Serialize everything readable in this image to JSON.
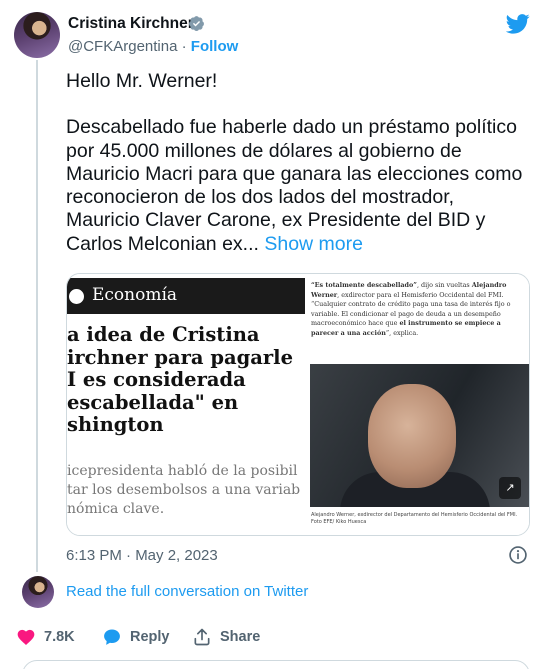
{
  "author": {
    "name": "Cristina Kirchner",
    "handle": "@CFKArgentina",
    "separator": "·",
    "follow_label": "Follow"
  },
  "tweet": {
    "greeting": "Hello Mr. Werner!",
    "body": "Descabellado fue haberle dado un préstamo político por 45.000 millones de dólares al gobierno de Mauricio Macri para que ganara las elecciones como reconocieron de los dos lados del mostrador, Mauricio Claver Carone, ex Presidente del BID y Carlos Melconian ex...",
    "show_more": "Show more",
    "timestamp": "6:13 PM · May 2, 2023"
  },
  "media": {
    "section": "Economía",
    "headline_lines": [
      "a idea de Cristina",
      "irchner para pagarle",
      "I es considerada",
      "escabellada\" en",
      "shington"
    ],
    "sub_lines": [
      "icepresidenta habló de la posibil",
      "tar los desembolsos a una variab",
      "nómica clave."
    ],
    "quote_parts": {
      "q1": "“Es totalmente descabellado”",
      "q2": ", dijo sin vueltas ",
      "q3": "Alejandro Werner",
      "q4": ", exdirector para el Hemisferio Occidental del FMI. “Cualquier contrato de crédito paga una tasa de interés fijo o variable. El condicionar el pago de deuda a un desempeño macroeconómico hace que ",
      "q5": "el instrumento se empiece a parecer a una acción",
      "q6": "”, explica."
    },
    "caption": "Alejandro Werner, exdirector del Departamento del Hemisferio Occidental del FMI. Foto EFE/ Kiko Huesca",
    "expand_icon": "↗"
  },
  "read_conversation": "Read the full conversation on Twitter",
  "actions": {
    "like_count": "7.8K",
    "reply_label": "Reply",
    "share_label": "Share"
  },
  "colors": {
    "accent": "#1d9bf0",
    "like": "#f91880",
    "text_secondary": "#536471"
  },
  "icons": [
    "verified-badge-icon",
    "twitter-bird-icon",
    "info-icon",
    "heart-icon",
    "reply-bubble-icon",
    "share-icon",
    "expand-icon"
  ]
}
